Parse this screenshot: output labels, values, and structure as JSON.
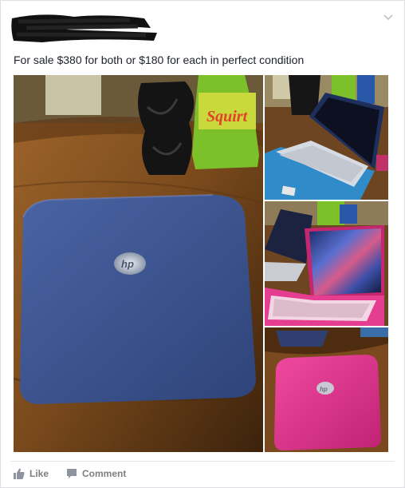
{
  "post": {
    "text": "For sale $380 for both or $180 for each in perfect condition"
  },
  "photos": {
    "main": {
      "logo": "hp",
      "bottle_brand": "Squirt",
      "subject": "blue laptop closed"
    },
    "thumb1": {
      "subject": "blue laptop open"
    },
    "thumb2": {
      "subject": "pink laptop open"
    },
    "thumb3": {
      "subject": "pink laptop closed",
      "logo": "hp"
    }
  },
  "actions": {
    "like_label": "Like",
    "comment_label": "Comment"
  },
  "icons": {
    "like": "thumbs-up-icon",
    "comment": "speech-bubble-icon",
    "menu": "chevron-down-icon"
  },
  "colors": {
    "card_bg": "#ffffff",
    "text": "#1d2129",
    "action_text": "#7f7f7f",
    "blue_laptop": "#3e5a9a",
    "pink_laptop": "#e0358e"
  }
}
